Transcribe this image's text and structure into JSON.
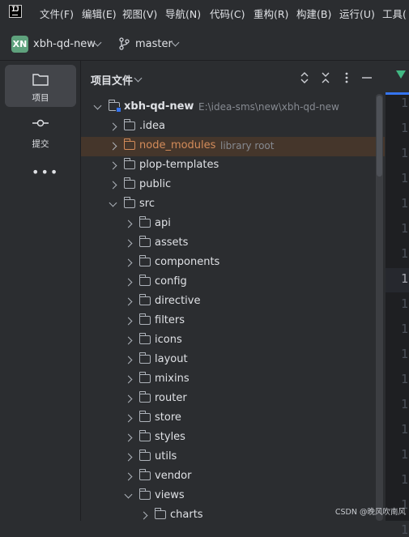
{
  "menu": {
    "items": [
      "文件(F)",
      "编辑(E)",
      "视图(V)",
      "导航(N)",
      "代码(C)",
      "重构(R)",
      "构建(B)",
      "运行(U)",
      "工具("
    ]
  },
  "toolbar": {
    "project_badge": "XN",
    "project_name": "xbh-qd-new",
    "branch": "master"
  },
  "toolstrip": {
    "project_label": "项目",
    "commit_label": "提交",
    "more_label": "•••"
  },
  "panel": {
    "title": "项目文件"
  },
  "tree": [
    {
      "label": "xbh-qd-new",
      "hint": "E:\\idea-sms\\new\\xbh-qd-new",
      "depth": 0,
      "expanded": true,
      "bold": true,
      "module": true
    },
    {
      "label": ".idea",
      "depth": 1,
      "expanded": false
    },
    {
      "label": "node_modules",
      "hint": "library root",
      "depth": 1,
      "expanded": false,
      "excluded": true,
      "selected": true
    },
    {
      "label": "plop-templates",
      "depth": 1,
      "expanded": false
    },
    {
      "label": "public",
      "depth": 1,
      "expanded": false
    },
    {
      "label": "src",
      "depth": 1,
      "expanded": true
    },
    {
      "label": "api",
      "depth": 2,
      "expanded": false
    },
    {
      "label": "assets",
      "depth": 2,
      "expanded": false
    },
    {
      "label": "components",
      "depth": 2,
      "expanded": false
    },
    {
      "label": "config",
      "depth": 2,
      "expanded": false
    },
    {
      "label": "directive",
      "depth": 2,
      "expanded": false
    },
    {
      "label": "filters",
      "depth": 2,
      "expanded": false
    },
    {
      "label": "icons",
      "depth": 2,
      "expanded": false
    },
    {
      "label": "layout",
      "depth": 2,
      "expanded": false
    },
    {
      "label": "mixins",
      "depth": 2,
      "expanded": false
    },
    {
      "label": "router",
      "depth": 2,
      "expanded": false
    },
    {
      "label": "store",
      "depth": 2,
      "expanded": false
    },
    {
      "label": "styles",
      "depth": 2,
      "expanded": false
    },
    {
      "label": "utils",
      "depth": 2,
      "expanded": false
    },
    {
      "label": "vendor",
      "depth": 2,
      "expanded": false
    },
    {
      "label": "views",
      "depth": 2,
      "expanded": true
    },
    {
      "label": "charts",
      "depth": 3,
      "expanded": false
    }
  ],
  "editor": {
    "line_numbers": [
      "1",
      "1",
      "1",
      "1",
      "1",
      "1",
      "1",
      "1",
      "1",
      "1",
      "1",
      "1",
      "1",
      "1",
      "1",
      "1",
      "1",
      "1"
    ],
    "current_index": 7
  },
  "watermark": "CSDN @晚风吹南风",
  "colors": {
    "accent": "#3574f0",
    "excluded": "#d48c5a",
    "project_badge": "#5fa27d",
    "selection": "#45362b",
    "vue": "#42b883"
  },
  "icons": {
    "app": "intellij-logo-icon",
    "branch": "git-branch-icon",
    "folder": "folder-icon"
  }
}
